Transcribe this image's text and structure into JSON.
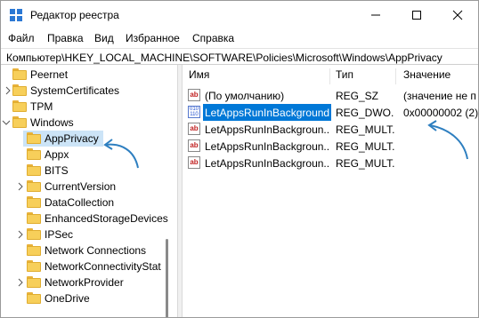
{
  "window": {
    "title": "Редактор реестра",
    "icons": [
      "registry-editor-icon",
      "minimize-icon",
      "maximize-icon",
      "close-icon"
    ]
  },
  "menu": [
    "Файл",
    "Правка",
    "Вид",
    "Избранное",
    "Справка"
  ],
  "address": "Компьютер\\HKEY_LOCAL_MACHINE\\SOFTWARE\\Policies\\Microsoft\\Windows\\AppPrivacy",
  "tree": [
    {
      "label": "Peernet",
      "expander": "none"
    },
    {
      "label": "SystemCertificates",
      "expander": "collapsed"
    },
    {
      "label": "TPM",
      "expander": "none"
    },
    {
      "label": "Windows",
      "expander": "expanded"
    },
    {
      "label": "AppPrivacy",
      "expander": "none",
      "selected": true
    },
    {
      "label": "Appx",
      "expander": "none"
    },
    {
      "label": "BITS",
      "expander": "none"
    },
    {
      "label": "CurrentVersion",
      "expander": "collapsed"
    },
    {
      "label": "DataCollection",
      "expander": "none"
    },
    {
      "label": "EnhancedStorageDevices",
      "expander": "none"
    },
    {
      "label": "IPSec",
      "expander": "collapsed"
    },
    {
      "label": "Network Connections",
      "expander": "none"
    },
    {
      "label": "NetworkConnectivityStat",
      "expander": "none"
    },
    {
      "label": "NetworkProvider",
      "expander": "collapsed"
    },
    {
      "label": "OneDrive",
      "expander": "none"
    }
  ],
  "columns": {
    "name": "Имя",
    "type": "Тип",
    "value": "Значение"
  },
  "values": [
    {
      "icon": "string-value-icon",
      "name": "(По умолчанию)",
      "type": "REG_SZ",
      "data": "(значение не п"
    },
    {
      "icon": "binary-value-icon",
      "name": "LetAppsRunInBackground",
      "type": "REG_DWO...",
      "data": "0x00000002 (2)",
      "selected": true
    },
    {
      "icon": "string-value-icon",
      "name": "LetAppsRunInBackgroun...",
      "type": "REG_MULT...",
      "data": ""
    },
    {
      "icon": "string-value-icon",
      "name": "LetAppsRunInBackgroun...",
      "type": "REG_MULT...",
      "data": ""
    },
    {
      "icon": "string-value-icon",
      "name": "LetAppsRunInBackgroun...",
      "type": "REG_MULT...",
      "data": ""
    }
  ],
  "colors": {
    "selection": "#0078d7",
    "tree_selection": "#cce4f7",
    "annotation_arrow": "#2e7fc0",
    "folder": "#f7cf5a"
  }
}
